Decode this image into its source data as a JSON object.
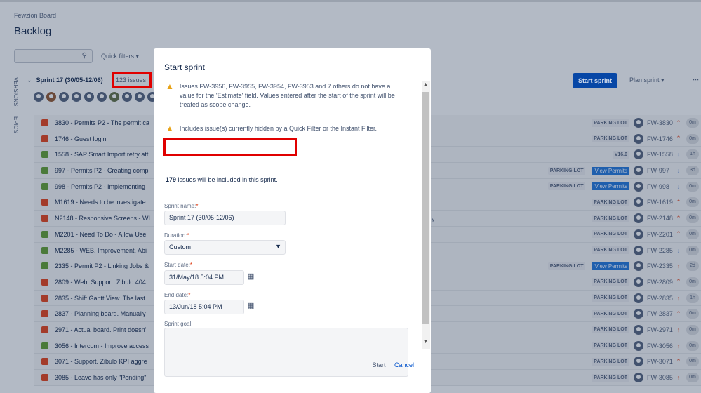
{
  "board": {
    "project": "Fewzion Board",
    "title": "Backlog"
  },
  "filters": {
    "search_placeholder": "",
    "quick_filters": "Quick filters ▾"
  },
  "side_tabs": {
    "versions": "VERSIONS",
    "epics": "EPICS"
  },
  "sprint": {
    "name": "Sprint 17 (30/05-12/06)",
    "issue_count": "123 issues",
    "start_button": "Start sprint",
    "plan_button": "Plan sprint ▾",
    "more": "⋯"
  },
  "rows": [
    {
      "type": "bug",
      "text": "3830 - Permits P2 - The permit ca",
      "epic": "PARKING LOT",
      "version": "",
      "key": "FW-3830",
      "prio": "up2",
      "est": "0m"
    },
    {
      "type": "bug",
      "text": "1746 - Guest login",
      "epic": "PARKING LOT",
      "version": "",
      "key": "FW-1746",
      "prio": "up2",
      "est": "0m"
    },
    {
      "type": "story",
      "text": "1558 - SAP Smart Import retry att",
      "epic": "V16.0",
      "version": "",
      "key": "FW-1558",
      "prio": "down",
      "est": "1h"
    },
    {
      "type": "story",
      "text": "997 - Permits P2 - Creating comp",
      "epic": "PARKING LOT",
      "version": "View Permits",
      "key": "FW-997",
      "prio": "down",
      "est": "3d"
    },
    {
      "type": "story",
      "text": "998 - Permits P2 - Implementing",
      "epic": "PARKING LOT",
      "version": "View Permits",
      "key": "FW-998",
      "prio": "down",
      "est": "0m"
    },
    {
      "type": "bug",
      "text": "M1619 - Needs to be investigate",
      "epic": "PARKING LOT",
      "version": "",
      "key": "FW-1619",
      "prio": "up2",
      "est": "0m"
    },
    {
      "type": "bug",
      "text": "N2148 - Responsive Screens - WI",
      "epic": "PARKING LOT",
      "version": "",
      "key": "FW-2148",
      "prio": "up2",
      "est": "0m"
    },
    {
      "type": "story",
      "text": "M2201 - Need To Do - Allow Use",
      "epic": "PARKING LOT",
      "version": "",
      "key": "FW-2201",
      "prio": "up2",
      "est": "0m"
    },
    {
      "type": "story",
      "text": "M2285 - WEB. Improvement. Abi",
      "epic": "PARKING LOT",
      "version": "",
      "key": "FW-2285",
      "prio": "down",
      "est": "0m"
    },
    {
      "type": "story",
      "text": "2335 - Permit P2 - Linking Jobs &",
      "epic": "PARKING LOT",
      "version": "View Permits",
      "key": "FW-2335",
      "prio": "up",
      "est": "2d"
    },
    {
      "type": "bug",
      "text": "2809 - Web. Support. Zibulo 404",
      "epic": "PARKING LOT",
      "version": "",
      "key": "FW-2809",
      "prio": "up2",
      "est": "0m"
    },
    {
      "type": "bug",
      "text": "2835 - Shift Gantt View. The last",
      "epic": "PARKING LOT",
      "version": "",
      "key": "FW-2835",
      "prio": "up",
      "est": "1h"
    },
    {
      "type": "bug",
      "text": "2837 - Planning board. Manually",
      "epic": "PARKING LOT",
      "version": "",
      "key": "FW-2837",
      "prio": "up2",
      "est": "0m"
    },
    {
      "type": "bug",
      "text": "2971 - Actual board. Print doesn'",
      "epic": "PARKING LOT",
      "version": "",
      "key": "FW-2971",
      "prio": "up",
      "est": "0m"
    },
    {
      "type": "story",
      "text": "3056 - Intercom - Improve access",
      "epic": "PARKING LOT",
      "version": "",
      "key": "FW-3056",
      "prio": "up",
      "est": "0m"
    },
    {
      "type": "bug",
      "text": "3071 - Support. Zibulo KPI aggre",
      "epic": "PARKING LOT",
      "version": "",
      "key": "FW-3071",
      "prio": "up2",
      "est": "0m"
    },
    {
      "type": "bug",
      "text": "3085 - Leave has only \"Pending\"",
      "epic": "PARKING LOT",
      "version": "",
      "key": "FW-3085",
      "prio": "up",
      "est": "0m"
    }
  ],
  "row_overflow_text": "y",
  "modal": {
    "title": "Start sprint",
    "warning1": "Issues FW-3956, FW-3955, FW-3954, FW-3953 and 7 others do not have a value for the 'Estimate' field. Values entered after the start of the sprint will be treated as scope change.",
    "warning2": "Includes issue(s) currently hidden by a Quick Filter or the Instant Filter.",
    "included_count": "179",
    "included_text": " issues will be included in this sprint.",
    "sprint_name_label": "Sprint name:",
    "sprint_name_value": "Sprint 17 (30/05-12/06)",
    "duration_label": "Duration:",
    "duration_value": "Custom",
    "start_date_label": "Start date:",
    "start_date_value": "31/May/18 5:04 PM",
    "end_date_label": "End date:",
    "end_date_value": "13/Jun/18 5:04 PM",
    "goal_label": "Sprint goal:",
    "required_mark": "*",
    "start_button": "Start",
    "cancel_link": "Cancel"
  },
  "colors": {
    "accent": "#0747a6",
    "highlight": "#e00000",
    "link": "#0052cc"
  }
}
